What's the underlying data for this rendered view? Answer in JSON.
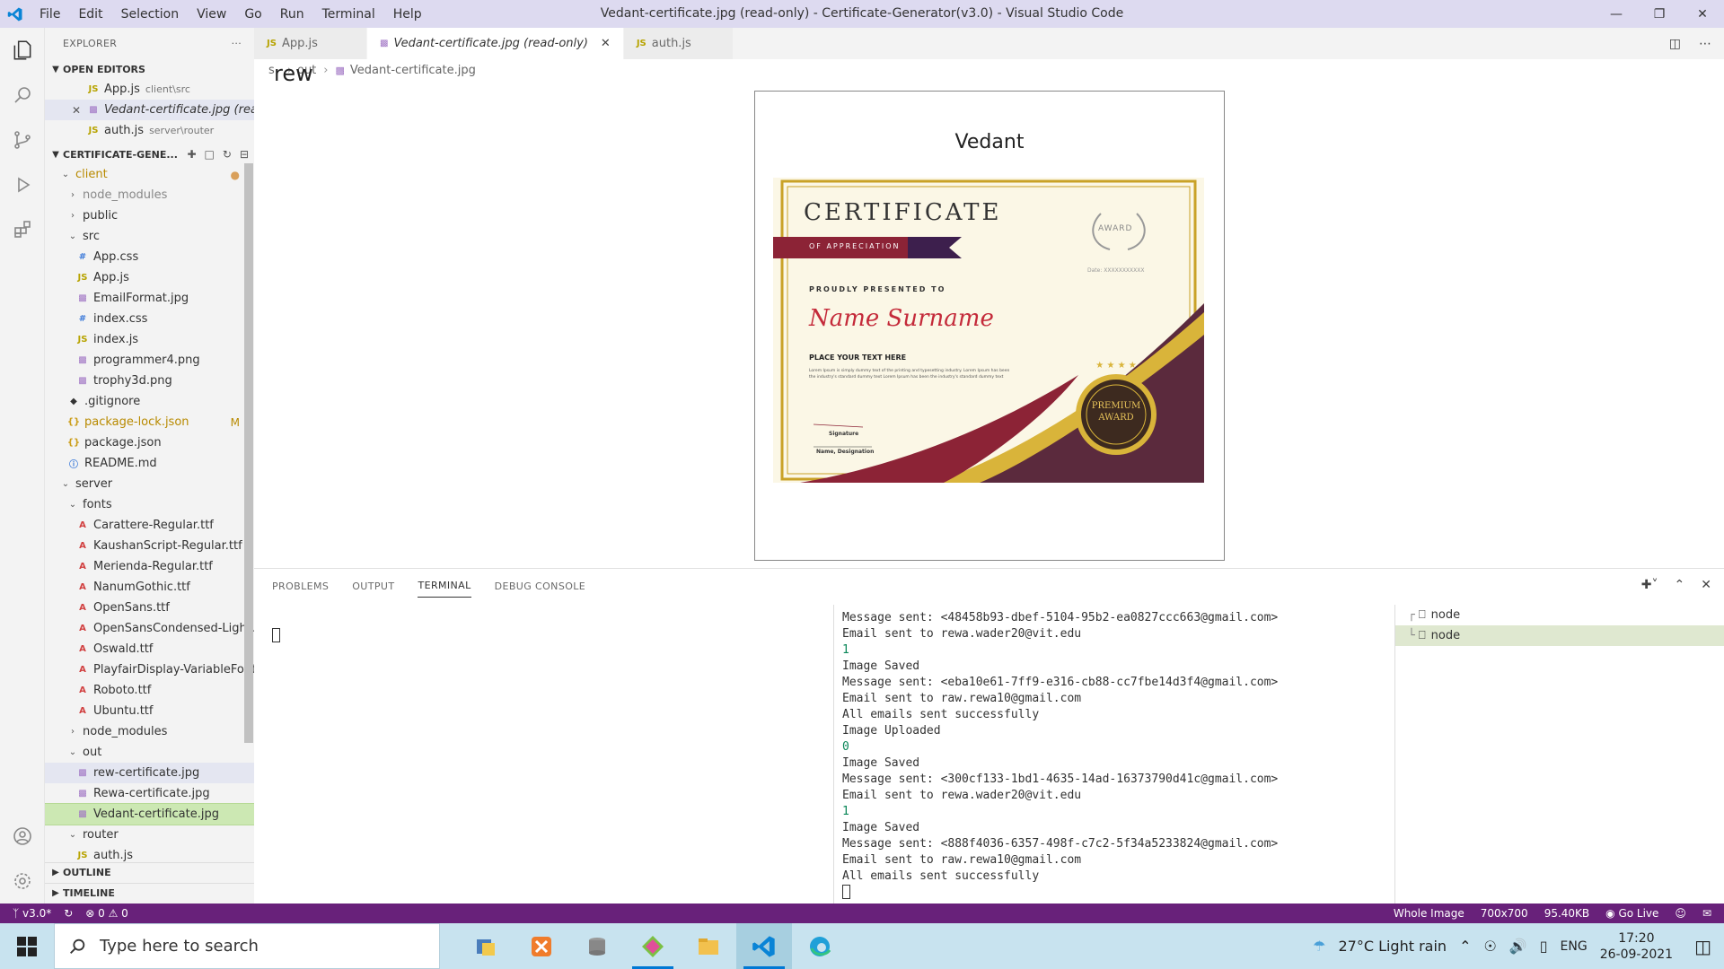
{
  "titlebar": {
    "menu": [
      "File",
      "Edit",
      "Selection",
      "View",
      "Go",
      "Run",
      "Terminal",
      "Help"
    ],
    "title": "Vedant-certificate.jpg (read-only) - Certificate-Generator(v3.0) - Visual Studio Code"
  },
  "explorer": {
    "header": "EXPLORER",
    "more": "···",
    "open_editors_label": "OPEN EDITORS",
    "open_editors": [
      {
        "name": "App.js",
        "path": "client\\src"
      },
      {
        "name": "Vedant-certificate.jpg (rea...",
        "path": ""
      },
      {
        "name": "auth.js",
        "path": "server\\router"
      }
    ],
    "project_label": "CERTIFICATE-GENE...",
    "tree": [
      {
        "name": "client"
      },
      {
        "name": "node_modules"
      },
      {
        "name": "public"
      },
      {
        "name": "src"
      },
      {
        "name": "App.css"
      },
      {
        "name": "App.js"
      },
      {
        "name": "EmailFormat.jpg"
      },
      {
        "name": "index.css"
      },
      {
        "name": "index.js"
      },
      {
        "name": "programmer4.png"
      },
      {
        "name": "trophy3d.png"
      },
      {
        "name": ".gitignore"
      },
      {
        "name": "package-lock.json",
        "badge": "M"
      },
      {
        "name": "package.json"
      },
      {
        "name": "README.md"
      },
      {
        "name": "server"
      },
      {
        "name": "fonts"
      },
      {
        "name": "Carattere-Regular.ttf"
      },
      {
        "name": "KaushanScript-Regular.ttf"
      },
      {
        "name": "Merienda-Regular.ttf"
      },
      {
        "name": "NanumGothic.ttf"
      },
      {
        "name": "OpenSans.ttf"
      },
      {
        "name": "OpenSansCondensed-Light.ttf"
      },
      {
        "name": "Oswald.ttf"
      },
      {
        "name": "PlayfairDisplay-VariableFont..."
      },
      {
        "name": "Roboto.ttf"
      },
      {
        "name": "Ubuntu.ttf"
      },
      {
        "name": "node_modules"
      },
      {
        "name": "out"
      },
      {
        "name": "rew-certificate.jpg"
      },
      {
        "name": "Rewa-certificate.jpg"
      },
      {
        "name": "Vedant-certificate.jpg"
      },
      {
        "name": "router"
      },
      {
        "name": "auth.js"
      }
    ],
    "outline_label": "OUTLINE",
    "timeline_label": "TIMELINE"
  },
  "tabs": [
    {
      "label": "App.js"
    },
    {
      "label": "Vedant-certificate.jpg (read-only)"
    },
    {
      "label": "auth.js"
    }
  ],
  "breadcrumb": {
    "part1": "s",
    "part2": "out",
    "part3": "Vedant-certificate.jpg",
    "overlay": "rew"
  },
  "certificate": {
    "name": "Vedant",
    "title": "CERTIFICATE",
    "ribbon": "OF APPRECIATION",
    "presented": "PROUDLY PRESENTED TO",
    "script_name": "Name Surname",
    "place_text": "PLACE YOUR TEXT HERE",
    "lorem1": "Lorem Ipsum is simply dummy text of the printing and typesetting industry. Lorem Ipsum has been",
    "lorem2": "the industry's standard dummy text Lorem Ipsum has been the industry's standard dummy text",
    "signature": "Signature",
    "designation": "Name, Designation",
    "award": "AWARD",
    "date": "Date: XXXXXXXXXXX",
    "seal1": "PREMIUM",
    "seal2": "AWARD"
  },
  "panel": {
    "tabs": [
      "PROBLEMS",
      "OUTPUT",
      "TERMINAL",
      "DEBUG CONSOLE"
    ],
    "terminal_lines": [
      "Message sent: <48458b93-dbef-5104-95b2-ea0827ccc663@gmail.com>",
      "Email sent to rewa.wader20@vit.edu",
      "1",
      "Image Saved",
      "Message sent: <eba10e61-7ff9-e316-cb88-cc7fbe14d3f4@gmail.com>",
      "Email sent to raw.rewa10@gmail.com",
      "All emails sent successfully",
      "Image Uploaded",
      "0",
      "Image Saved",
      "Message sent: <300cf133-1bd1-4635-14ad-16373790d41c@gmail.com>",
      "Email sent to rewa.wader20@vit.edu",
      "1",
      "Image Saved",
      "Message sent: <888f4036-6357-498f-c7c2-5f34a5233824@gmail.com>",
      "Email sent to raw.rewa10@gmail.com",
      "All emails sent successfully"
    ],
    "terminal_instances": [
      "node",
      "node"
    ]
  },
  "statusbar": {
    "branch": "v3.0*",
    "errors": "0",
    "warnings": "0",
    "whole_image": "Whole Image",
    "dims": "700x700",
    "size": "95.40KB",
    "golive": "Go Live"
  },
  "taskbar": {
    "search_placeholder": "Type here to search",
    "weather": "27°C  Light rain",
    "lang": "ENG",
    "time": "17:20",
    "date": "26-09-2021"
  },
  "colors": {
    "statusbar": "#68217a",
    "titlebar": "#dddaf0",
    "selected": "#cce8b3"
  }
}
